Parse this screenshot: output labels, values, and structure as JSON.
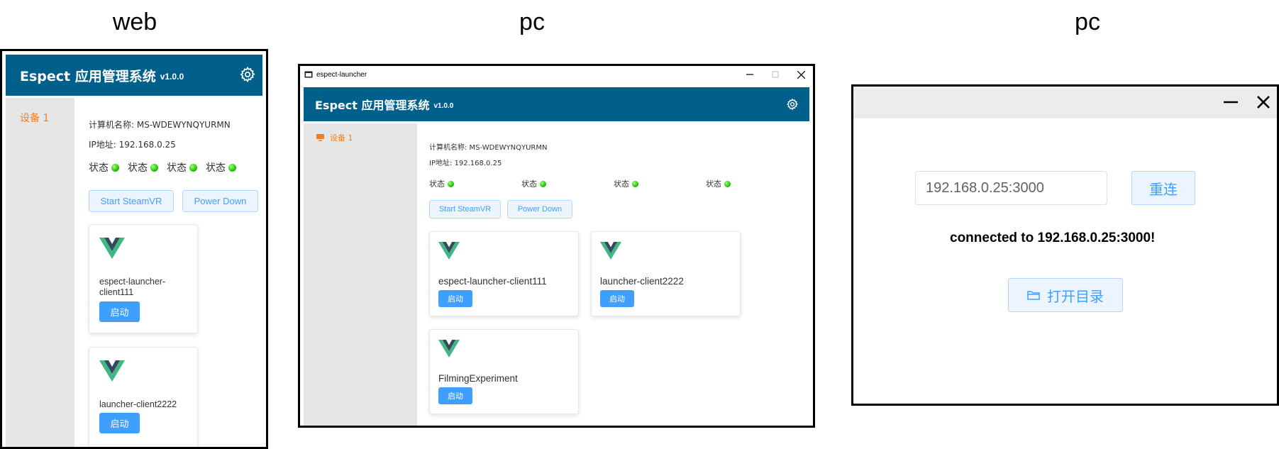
{
  "captions": [
    "web",
    "pc",
    "pc"
  ],
  "colors": {
    "header": "#015f8c",
    "accent": "#409eff",
    "sidebar": "#e6e6e6",
    "active_side": "#f47e20",
    "status_ok": "#21c500"
  },
  "app": {
    "title": "Espect 应用管理系统",
    "version": "v1.0.0"
  },
  "window": {
    "title": "espect-launcher"
  },
  "sidebar": {
    "items": [
      {
        "label": "设备 1",
        "icon": "monitor-icon"
      }
    ]
  },
  "device": {
    "computer_name": "计算机名称: MS-WDEWYNQYURMN",
    "ip": "IP地址: 192.168.0.25",
    "status_label": "状态",
    "statuses": [
      "ok",
      "ok",
      "ok",
      "ok"
    ]
  },
  "actions": {
    "start_steamvr": "Start SteamVR",
    "power_down": "Power Down"
  },
  "apps": [
    {
      "name": "espect-launcher-client111",
      "launch": "启动",
      "icon": "vue-logo-icon"
    },
    {
      "name": "launcher-client2222",
      "launch": "启动",
      "icon": "vue-logo-icon"
    },
    {
      "name": "FilmingExperiment",
      "launch": "启动",
      "icon": "vue-logo-icon"
    }
  ],
  "web_apps": {
    "name1_line1": "espect-launcher-",
    "name1_line2": "client111"
  },
  "connect": {
    "address": "192.168.0.25:3000",
    "reconnect": "重连",
    "message": "connected to 192.168.0.25:3000!",
    "open_dir": "打开目录"
  }
}
